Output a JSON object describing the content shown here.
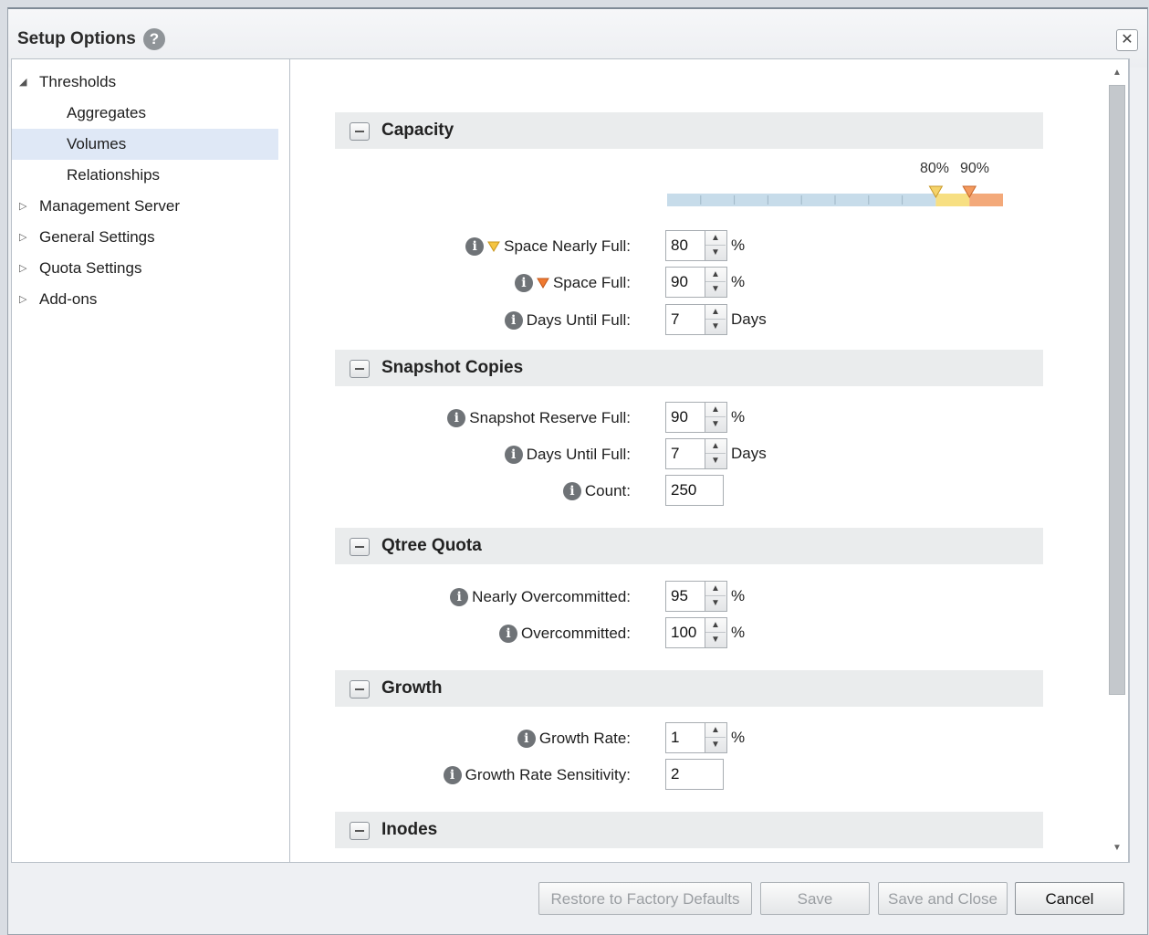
{
  "dialog": {
    "title": "Setup Options",
    "help_icon": "?",
    "close_icon": "✕"
  },
  "sidebar": {
    "items": [
      {
        "label": "Thresholds",
        "arrow": "◢",
        "level": 0,
        "expanded": true
      },
      {
        "label": "Aggregates",
        "level": 1
      },
      {
        "label": "Volumes",
        "level": 1,
        "selected": true
      },
      {
        "label": "Relationships",
        "level": 1
      },
      {
        "label": "Management Server",
        "arrow": "▷",
        "level": 0
      },
      {
        "label": "General Settings",
        "arrow": "▷",
        "level": 0
      },
      {
        "label": "Quota Settings",
        "arrow": "▷",
        "level": 0
      },
      {
        "label": "Add-ons",
        "arrow": "▷",
        "level": 0
      }
    ]
  },
  "capacity_bar": {
    "nearly_full_marker": "80%",
    "full_marker": "90%",
    "nearly_full_value": 80,
    "full_value": 90,
    "color_normal": "#c7dcea",
    "color_warning": "#f7df82",
    "color_error": "#f3a97a"
  },
  "sections": {
    "capacity": {
      "title": "Capacity",
      "fields": {
        "space_nearly_full": {
          "label": "Space Nearly Full:",
          "value": "80",
          "unit": "%"
        },
        "space_full": {
          "label": "Space Full:",
          "value": "90",
          "unit": "%"
        },
        "days_until_full": {
          "label": "Days Until Full:",
          "value": "7",
          "unit": "Days"
        }
      }
    },
    "snapshot": {
      "title": "Snapshot Copies",
      "fields": {
        "reserve_full": {
          "label": "Snapshot Reserve Full:",
          "value": "90",
          "unit": "%"
        },
        "days_until_full": {
          "label": "Days Until Full:",
          "value": "7",
          "unit": "Days"
        },
        "count": {
          "label": "Count:",
          "value": "250"
        }
      }
    },
    "qtree": {
      "title": "Qtree Quota",
      "fields": {
        "nearly_overcommitted": {
          "label": "Nearly Overcommitted:",
          "value": "95",
          "unit": "%"
        },
        "overcommitted": {
          "label": "Overcommitted:",
          "value": "100",
          "unit": "%"
        }
      }
    },
    "growth": {
      "title": "Growth",
      "fields": {
        "growth_rate": {
          "label": "Growth Rate:",
          "value": "1",
          "unit": "%"
        },
        "sensitivity": {
          "label": "Growth Rate Sensitivity:",
          "value": "2"
        }
      }
    },
    "inodes": {
      "title": "Inodes"
    }
  },
  "footer": {
    "restore_label": "Restore to Factory Defaults",
    "save_label": "Save",
    "save_close_label": "Save and Close",
    "cancel_label": "Cancel"
  },
  "icons": {
    "info": "i",
    "spin_up": "▲",
    "spin_down": "▼",
    "scroll_up": "▲",
    "scroll_down": "▼"
  }
}
